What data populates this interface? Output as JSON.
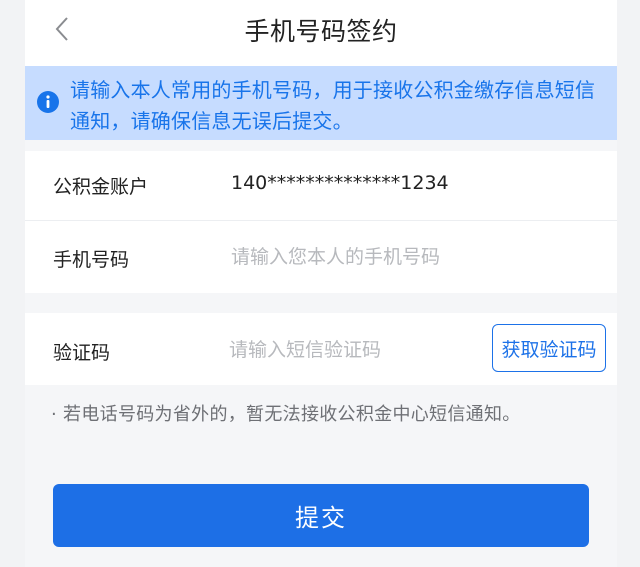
{
  "nav": {
    "title": "手机号码签约"
  },
  "notice": {
    "text": "请输入本人常用的手机号码，用于接收公积金缴存信息短信通知，请确保信息无误后提交。"
  },
  "form": {
    "account_label": "公积金账户",
    "account_value": "140**************1234",
    "phone_label": "手机号码",
    "phone_placeholder": "请输入您本人的手机号码",
    "code_label": "验证码",
    "code_placeholder": "请输入短信验证码",
    "get_code_label": "获取验证码"
  },
  "tip": "· 若电话号码为省外的，暂无法接收公积金中心短信通知。",
  "submit_label": "提交",
  "colors": {
    "accent": "#1d6fe6",
    "notice_bg": "#c6dcff",
    "notice_text": "#1874ea",
    "placeholder": "#b7b9bd"
  }
}
